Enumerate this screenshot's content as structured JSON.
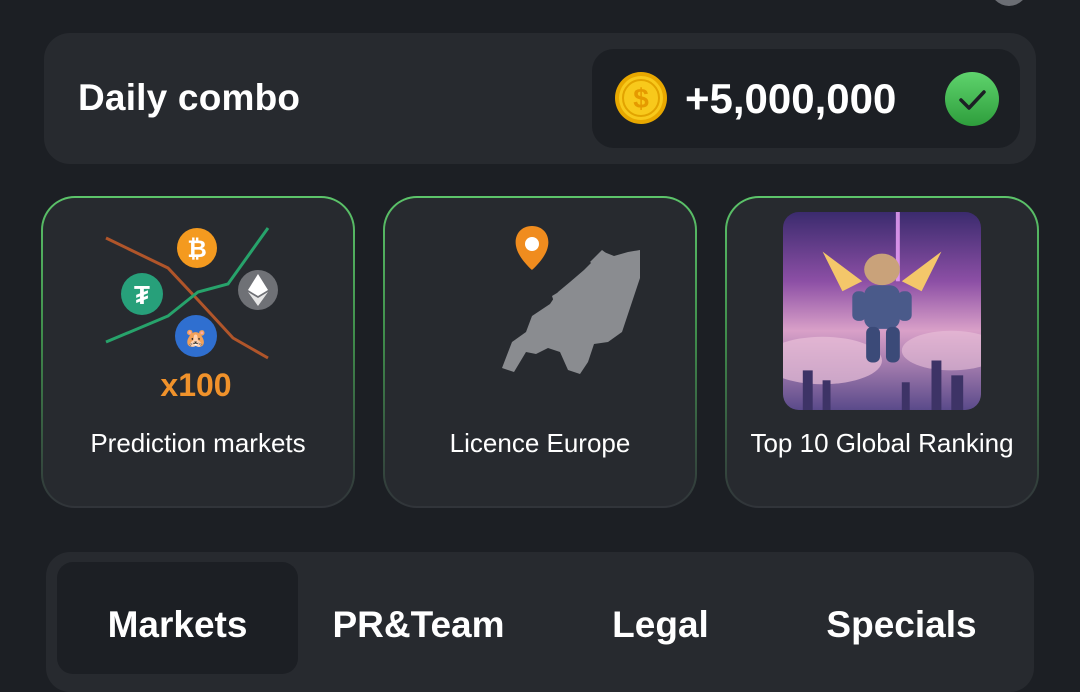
{
  "daily_combo": {
    "title": "Daily combo",
    "reward": "+5,000,000",
    "completed": true
  },
  "cards": [
    {
      "label": "Prediction markets",
      "badge": "x100"
    },
    {
      "label": "Licence Europe"
    },
    {
      "label": "Top 10 Global Ranking"
    }
  ],
  "tabs": [
    {
      "label": "Markets",
      "active": true
    },
    {
      "label": "PR&Team",
      "active": false
    },
    {
      "label": "Legal",
      "active": false
    },
    {
      "label": "Specials",
      "active": false
    }
  ],
  "colors": {
    "background": "#1c1f24",
    "panel": "#272a2f",
    "accent_green": "#4fbf5b",
    "coin_gold": "#f5c518",
    "badge_orange": "#f0922b"
  }
}
